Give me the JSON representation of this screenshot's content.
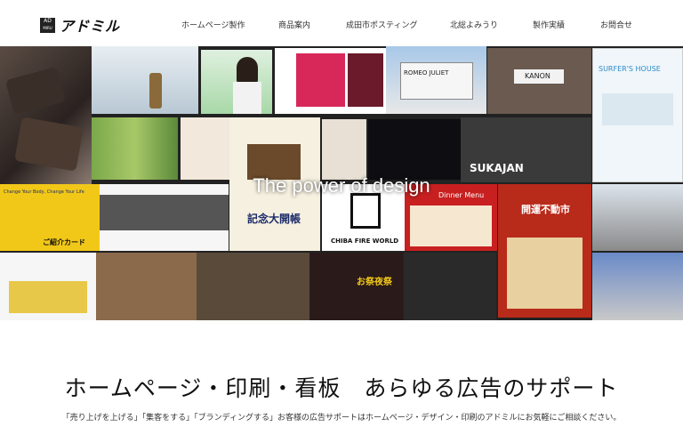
{
  "logo": {
    "mark_top": "AD",
    "mark_bottom": "MIRU",
    "name": "アドミル"
  },
  "nav": [
    "ホームページ製作",
    "商品案内",
    "成田市ポスティング",
    "北総よみうり",
    "製作実績",
    "お問合せ"
  ],
  "hero": {
    "overlay_text": "The power of design",
    "tile_texts": {
      "romeo": "ROMEO JULIET",
      "kanon": "KANON",
      "surfers": "SURFER'S HOUSE",
      "sukajan": "SUKAJAN",
      "memorial": "記念大開帳",
      "fireworld": "CHIBA FIRE WORLD",
      "dinner": "Dinner Menu",
      "fudosan": "開運不動市",
      "card": "ご紹介カード",
      "change": "Change Your Body, Change Your Life",
      "festival": "お祭夜祭"
    }
  },
  "headline": "ホームページ・印刷・看板　あらゆる広告のサポート",
  "subline": "「売り上げを上げる」「集客をする」「ブランディングする」お客様の広告サポートはホームページ・デザイン・印刷のアドミルにお気軽にご相談ください。"
}
